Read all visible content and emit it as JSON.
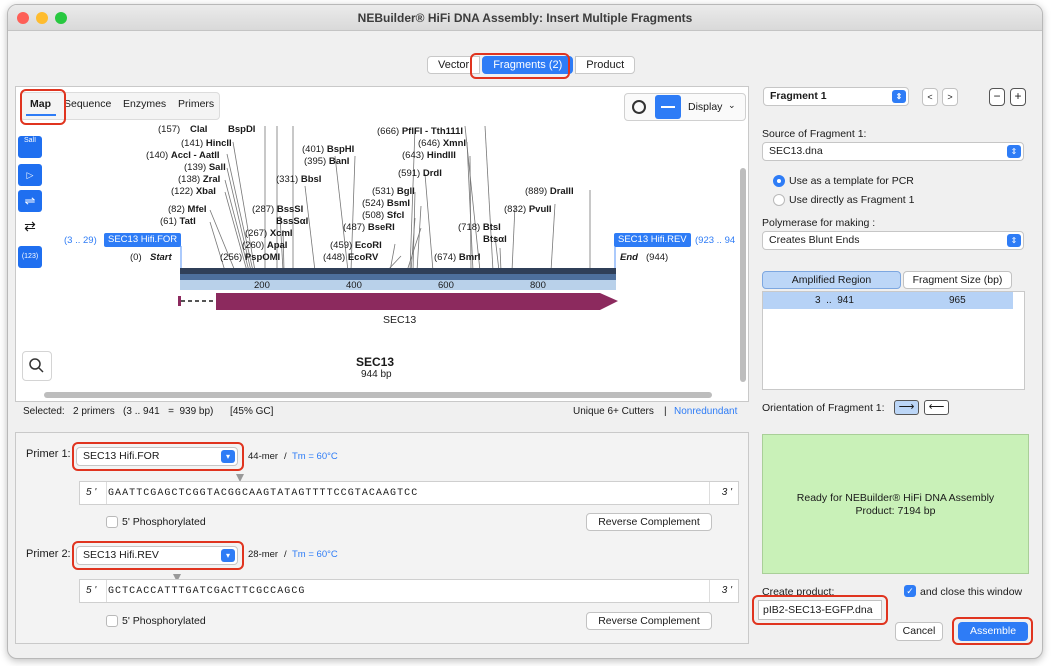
{
  "window": {
    "title": "NEBuilder® HiFi DNA Assembly: Insert Multiple Fragments"
  },
  "top_tabs": [
    {
      "label": "Vector"
    },
    {
      "label": "Fragments (2)"
    },
    {
      "label": "Product"
    }
  ],
  "map_panel": {
    "subtabs": [
      "Map",
      "Sequence",
      "Enzymes",
      "Primers"
    ],
    "display_label": "Display",
    "left_tools": [
      "SalI",
      "▷",
      "⇌",
      "⇄",
      "(123)"
    ],
    "enzymes": [
      {
        "pos": "(141)",
        "name": "HincII"
      },
      {
        "pos": "(140)",
        "name": "AccI - AatII"
      },
      {
        "pos": "(139)",
        "name": "SalI"
      },
      {
        "pos": "(138)",
        "name": "ZraI"
      },
      {
        "pos": "(122)",
        "name": "XbaI"
      },
      {
        "pos": "(82)",
        "name": "MfeI"
      },
      {
        "pos": "(61)",
        "name": "TatI"
      },
      {
        "pos": "(331)",
        "name": "BbsI"
      },
      {
        "pos": "(287)",
        "name": "BssSI"
      },
      {
        "pos": "",
        "name": "BssSαI"
      },
      {
        "pos": "(267)",
        "name": "XcmI"
      },
      {
        "pos": "(260)",
        "name": "ApaI"
      },
      {
        "pos": "(256)",
        "name": "PspOMI"
      },
      {
        "pos": "(401)",
        "name": "BspHI"
      },
      {
        "pos": "(395)",
        "name": "BanI"
      },
      {
        "pos": "(666)",
        "name": "PflFI - Tth111I"
      },
      {
        "pos": "(646)",
        "name": "XmnI"
      },
      {
        "pos": "(643)",
        "name": "HindIII"
      },
      {
        "pos": "(591)",
        "name": "DrdI"
      },
      {
        "pos": "(531)",
        "name": "BglI"
      },
      {
        "pos": "(524)",
        "name": "BsmI"
      },
      {
        "pos": "(508)",
        "name": "SfcI"
      },
      {
        "pos": "(487)",
        "name": "BseRI"
      },
      {
        "pos": "(459)",
        "name": "EcoRI"
      },
      {
        "pos": "(448)",
        "name": "EcoRV"
      },
      {
        "pos": "(674)",
        "name": "BmrI"
      },
      {
        "pos": "(718)",
        "name": "BtsI"
      },
      {
        "pos": "",
        "name": "BtsαI"
      },
      {
        "pos": "(889)",
        "name": "DraIII"
      },
      {
        "pos": "(832)",
        "name": "PvuII"
      }
    ],
    "top_cut_labels": [
      "(157)",
      "ClaI",
      "BspDI"
    ],
    "primer_for_range": "(3 .. 29)",
    "primer_for_name": "SEC13 Hifi.FOR",
    "primer_rev_name": "SEC13 Hifi.REV",
    "primer_rev_range": "(923 .. 94",
    "start_pos": "(0)",
    "start_label": "Start",
    "end_label": "End",
    "end_pos": "(944)",
    "ruler_ticks": [
      "200",
      "400",
      "600",
      "800"
    ],
    "feature_label": "SEC13",
    "seq_name": "SEC13",
    "seq_length": "944 bp"
  },
  "status_bar": {
    "selected": "Selected:   2 primers   (3 .. 941   =  939 bp)      [45% GC]",
    "cutters": "Unique 6+ Cutters",
    "sep": "|",
    "nonredundant": "Nonredundant"
  },
  "primers": [
    {
      "label": "Primer 1:",
      "name": "SEC13 Hifi.FOR",
      "length": "44-mer",
      "sep": "/",
      "tm": "Tm = 60°C",
      "five": "5 '",
      "three": "3 '",
      "sequence": "GAATTCGAGCTCGGTACGGCAAGTATAGTTTTCCGTACAAGTCC",
      "phos": "5' Phosphorylated",
      "revcomp": "Reverse Complement"
    },
    {
      "label": "Primer 2:",
      "name": "SEC13 Hifi.REV",
      "length": "28-mer",
      "sep": "/",
      "tm": "Tm = 60°C",
      "five": "5 '",
      "three": "3 '",
      "sequence": "GCTCACCATTTGATCGACTTCGCCAGCG",
      "phos": "5' Phosphorylated",
      "revcomp": "Reverse Complement"
    }
  ],
  "right_panel": {
    "fragment_select": "Fragment 1",
    "nav_prev": "<",
    "nav_next": ">",
    "minus": "−",
    "plus": "+",
    "source_label": "Source of Fragment 1:",
    "source_value": "SEC13.dna",
    "radio1": "Use as a template for PCR",
    "radio2": "Use directly as Fragment 1",
    "polymerase_label": "Polymerase for making :",
    "polymerase_value": "Creates Blunt Ends",
    "col1": "Amplified Region",
    "col2": "Fragment Size (bp)",
    "row_region": "3  ..  941",
    "row_size": "965",
    "orientation_label": "Orientation of Fragment 1:",
    "ready_line1": "Ready for NEBuilder® HiFi DNA Assembly",
    "ready_line2": "Product:  7194 bp",
    "create_label": "Create product:",
    "close_label": "and close this window",
    "product_name": "pIB2-SEC13-EGFP.dna",
    "cancel": "Cancel",
    "assemble": "Assemble"
  },
  "colors": {
    "accent": "#2e7cf6",
    "highlight_red": "#e0341f",
    "feature": "#8c2a5e",
    "ready_bg": "#c9f1b8"
  }
}
